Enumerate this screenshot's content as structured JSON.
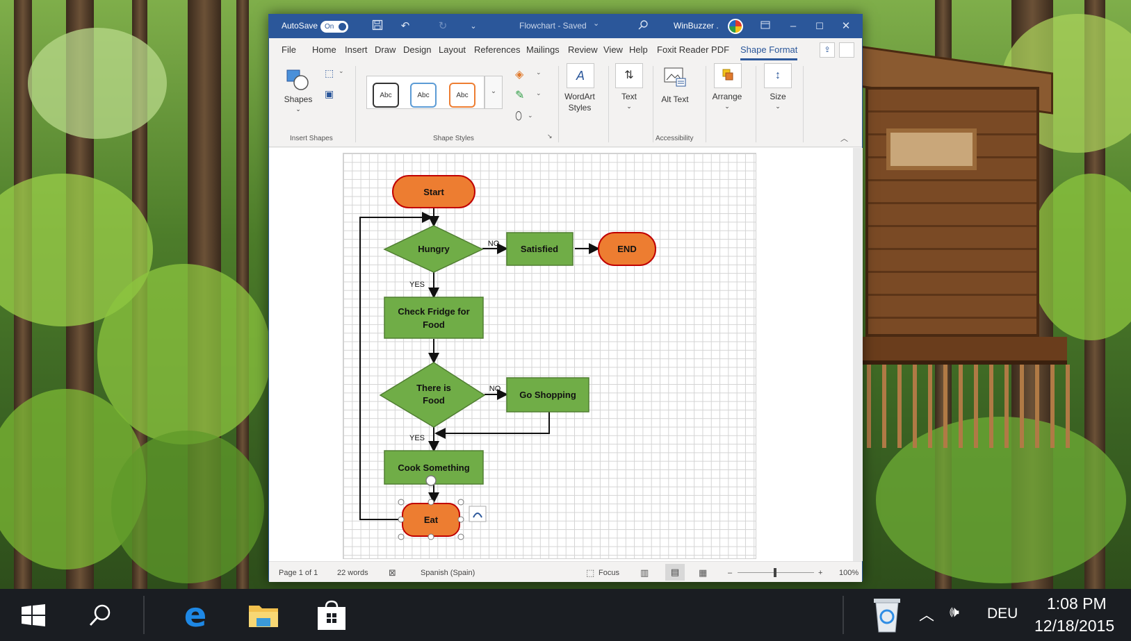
{
  "titlebar": {
    "autosave_label": "AutoSave",
    "autosave_state": "On",
    "doc_title": "Flowchart  -  Saved",
    "doc_title_chevron": "⌄",
    "user_name": "WinBuzzer ."
  },
  "menu_tabs": [
    {
      "label": "File"
    },
    {
      "label": "Home"
    },
    {
      "label": "Insert"
    },
    {
      "label": "Draw"
    },
    {
      "label": "Design"
    },
    {
      "label": "Layout"
    },
    {
      "label": "References"
    },
    {
      "label": "Mailings"
    },
    {
      "label": "Review"
    },
    {
      "label": "View"
    },
    {
      "label": "Help"
    },
    {
      "label": "Foxit Reader PDF"
    },
    {
      "label": "Shape Format"
    }
  ],
  "ribbon": {
    "shapes_label": "Shapes",
    "insert_shapes_group": "Insert Shapes",
    "style_samples": [
      "Abc",
      "Abc",
      "Abc"
    ],
    "shape_styles_group": "Shape Styles",
    "wordart_label": "WordArt Styles",
    "text_label": "Text",
    "alt_text_label": "Alt Text",
    "accessibility_group": "Accessibility",
    "arrange_label": "Arrange",
    "size_label": "Size"
  },
  "flowchart": {
    "start": "Start",
    "hungry": "Hungry",
    "no1": "NO",
    "satisfied": "Satisfied",
    "end": "END",
    "yes1": "YES",
    "check_fridge_1": "Check Fridge for",
    "check_fridge_2": "Food",
    "there_is_1": "There is",
    "there_is_2": "Food",
    "no2": "NO",
    "go_shopping": "Go Shopping",
    "yes2": "YES",
    "cook": "Cook Something",
    "eat": "Eat"
  },
  "status": {
    "page": "Page 1 of 1",
    "words": "22 words",
    "language": "Spanish (Spain)",
    "focus": "Focus",
    "zoom": "100%"
  },
  "colors": {
    "word_blue": "#2b579a",
    "green": "#70ad47",
    "orange": "#ed7d31",
    "taskbar": "#1a1d22"
  },
  "taskbar": {
    "language": "DEU",
    "time": "1:08 PM",
    "date": "12/18/2015"
  }
}
